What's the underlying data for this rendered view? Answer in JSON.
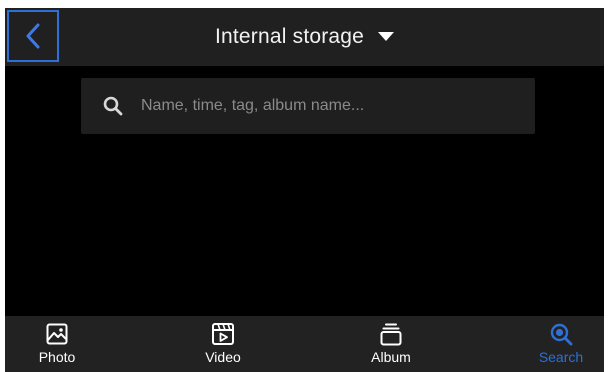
{
  "header": {
    "title": "Internal storage",
    "back_icon": "chevron-left-icon",
    "dropdown_icon": "caret-down-icon"
  },
  "search": {
    "placeholder": "Name, time, tag, album name...",
    "icon": "search-icon"
  },
  "bottom_nav": {
    "items": [
      {
        "label": "Photo",
        "icon": "photo-icon",
        "active": false
      },
      {
        "label": "Video",
        "icon": "video-icon",
        "active": false
      },
      {
        "label": "Album",
        "icon": "album-icon",
        "active": false
      },
      {
        "label": "Search",
        "icon": "search-icon",
        "active": true
      }
    ]
  },
  "colors": {
    "accent": "#2f6fd6",
    "background": "#000000",
    "bar": "#202020"
  }
}
